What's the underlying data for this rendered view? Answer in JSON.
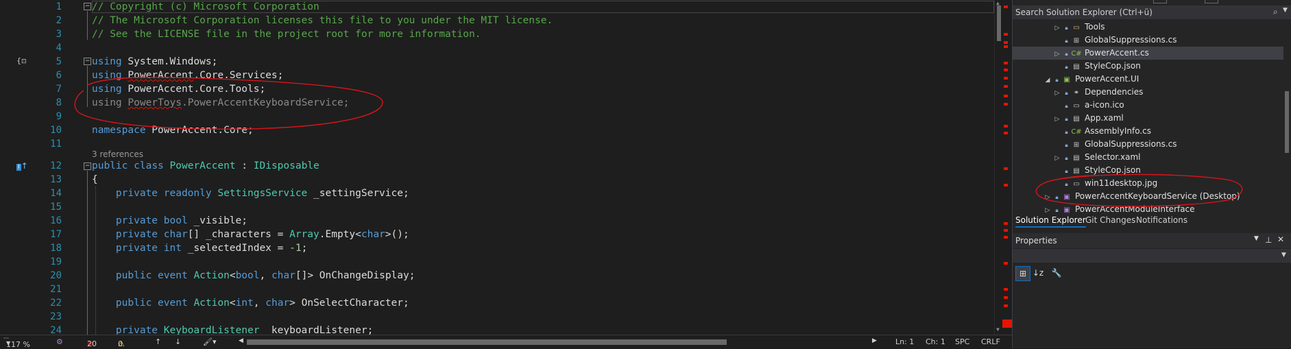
{
  "editor": {
    "lines": [
      {
        "n": "1",
        "html": "<span class=\"cm\">// Copyright (c) Microsoft Corporation</span>"
      },
      {
        "n": "2",
        "html": "<span class=\"cm\">// The Microsoft Corporation licenses this file to you under the MIT license.</span>"
      },
      {
        "n": "3",
        "html": "<span class=\"cm\">// See the LICENSE file in the project root for more information.</span>"
      },
      {
        "n": "4",
        "html": ""
      },
      {
        "n": "5",
        "html": "<span class=\"kw\">using</span> System.Windows;"
      },
      {
        "n": "6",
        "html": "<span class=\"kw\">using</span> <span class=\"squig\">PowerAccent</span>.Core.Services;"
      },
      {
        "n": "7",
        "html": "<span class=\"kw\">using</span> PowerAccent.Core.Tools;"
      },
      {
        "n": "8",
        "html": "<span class=\"dim\">using</span> <span class=\"dim squig\">PowerToys</span><span class=\"dim\">.PowerAccentKeyboardService;</span>"
      },
      {
        "n": "9",
        "html": ""
      },
      {
        "n": "10",
        "html": "<span class=\"kw\">namespace</span> PowerAccent.Core;"
      },
      {
        "n": "11",
        "html": ""
      },
      {
        "n": "12",
        "html": "<span class=\"kw\">public</span> <span class=\"kw\">class</span> <span class=\"ty\">PowerAccent</span> : <span class=\"ty\">IDisposable</span>"
      },
      {
        "n": "13",
        "html": "{"
      },
      {
        "n": "14",
        "html": "    <span class=\"kw\">private</span> <span class=\"kw\">readonly</span> <span class=\"ty\">SettingsService</span> _settingService;"
      },
      {
        "n": "15",
        "html": ""
      },
      {
        "n": "16",
        "html": "    <span class=\"kw\">private</span> <span class=\"kw\">bool</span> _visible;"
      },
      {
        "n": "17",
        "html": "    <span class=\"kw\">private</span> <span class=\"kw\">char</span>[] _characters = <span class=\"ty\">Array</span>.Empty&lt;<span class=\"kw\">char</span>&gt;();"
      },
      {
        "n": "18",
        "html": "    <span class=\"kw\">private</span> <span class=\"kw\">int</span> _selectedIndex = <span class=\"num\">-1</span>;"
      },
      {
        "n": "19",
        "html": ""
      },
      {
        "n": "20",
        "html": "    <span class=\"kw\">public</span> <span class=\"kw\">event</span> <span class=\"ty\">Action</span>&lt;<span class=\"kw\">bool</span>, <span class=\"kw\">char</span>[]&gt; OnChangeDisplay;"
      },
      {
        "n": "21",
        "html": ""
      },
      {
        "n": "22",
        "html": "    <span class=\"kw\">public</span> <span class=\"kw\">event</span> <span class=\"ty\">Action</span>&lt;<span class=\"kw\">int</span>, <span class=\"kw\">char</span>&gt; OnSelectCharacter;"
      },
      {
        "n": "23",
        "html": ""
      },
      {
        "n": "24",
        "html": "    <span class=\"kw\">private</span> <span class=\"ty\">KeyboardListener</span> _keyboardListener;"
      }
    ],
    "references_label": "3 references"
  },
  "status": {
    "zoom": "117 %",
    "errors": "20",
    "warnings": "0",
    "line": "Ln: 1",
    "col": "Ch: 1",
    "spc": "SPC",
    "eol": "CRLF"
  },
  "solution_explorer": {
    "search_placeholder": "Search Solution Explorer (Ctrl+ü)",
    "items": [
      {
        "label": "Tools",
        "indent": 4,
        "twisty": "▷",
        "icon": "folder-icon",
        "glyph": "▭"
      },
      {
        "label": "GlobalSuppressions.cs",
        "indent": 4,
        "twisty": "",
        "icon": "cs-file-icon",
        "glyph": "⊞"
      },
      {
        "label": "PowerAccent.cs",
        "indent": 4,
        "twisty": "▷",
        "icon": "csharp-icon",
        "glyph": "C#",
        "selected": true
      },
      {
        "label": "StyleCop.json",
        "indent": 4,
        "twisty": "",
        "icon": "json-file-icon",
        "glyph": "▤"
      },
      {
        "label": "PowerAccent.UI",
        "indent": 3,
        "twisty": "◢",
        "icon": "csharp-project-icon",
        "glyph": "▣"
      },
      {
        "label": "Dependencies",
        "indent": 4,
        "twisty": "▷",
        "icon": "dependencies-icon",
        "glyph": "⚭"
      },
      {
        "label": "a-icon.ico",
        "indent": 4,
        "twisty": "",
        "icon": "ico-file-icon",
        "glyph": "▭"
      },
      {
        "label": "App.xaml",
        "indent": 4,
        "twisty": "▷",
        "icon": "xaml-file-icon",
        "glyph": "▤"
      },
      {
        "label": "AssemblyInfo.cs",
        "indent": 4,
        "twisty": "",
        "icon": "csharp-icon",
        "glyph": "C#"
      },
      {
        "label": "GlobalSuppressions.cs",
        "indent": 4,
        "twisty": "",
        "icon": "cs-file-icon",
        "glyph": "⊞"
      },
      {
        "label": "Selector.xaml",
        "indent": 4,
        "twisty": "▷",
        "icon": "xaml-file-icon",
        "glyph": "▤"
      },
      {
        "label": "StyleCop.json",
        "indent": 4,
        "twisty": "",
        "icon": "json-file-icon",
        "glyph": "▤"
      },
      {
        "label": "win11desktop.jpg",
        "indent": 4,
        "twisty": "",
        "icon": "image-file-icon",
        "glyph": "▭"
      },
      {
        "label": "PowerAccentKeyboardService (Desktop)",
        "indent": 3,
        "twisty": "▷",
        "icon": "cpp-project-icon",
        "glyph": "▣"
      },
      {
        "label": "PowerAccentModuleInterface",
        "indent": 3,
        "twisty": "▷",
        "icon": "cpp-project-icon",
        "glyph": "▣"
      }
    ],
    "tabs": [
      "Solution Explorer",
      "Git Changes",
      "Notifications"
    ]
  },
  "properties": {
    "title": "Properties"
  }
}
